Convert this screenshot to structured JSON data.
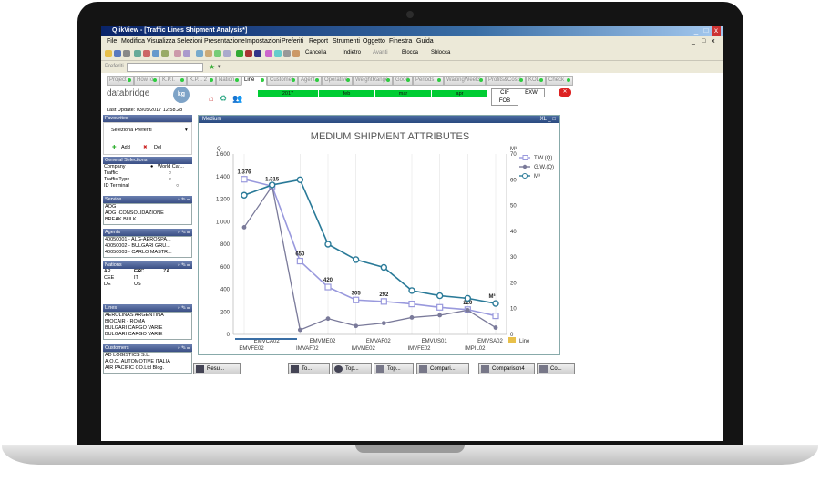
{
  "window": {
    "title": "QlikView - [Traffic Lines Shipment Analysis*]",
    "controls": [
      "_",
      "□",
      "x"
    ]
  },
  "menu": [
    "File",
    "Modifica",
    "Visualizza",
    "Selezioni",
    "Presentazione",
    "Impostazioni",
    "Preferiti",
    "Report",
    "Strumenti",
    "Oggetto",
    "Finestra",
    "Guida"
  ],
  "toolbar": {
    "cancella": "Cancella",
    "indietro": "Indietro",
    "avanti": "Avanti",
    "blocca": "Blocca",
    "sblocca": "Sblocca",
    "preferiti_label": "Preferiti"
  },
  "tabs": [
    "Project",
    "HowTo",
    "K.P.I.",
    "K.P.I. 2",
    "Nation",
    "Line",
    "Customer",
    "Agent",
    "Operative",
    "WeightRange",
    "Good",
    "Periods",
    "WaitingWeeks",
    "Profits&Costs",
    "KOL",
    "Check"
  ],
  "active_tab": "Line",
  "logo": {
    "name": "databridge",
    "badge": "kg"
  },
  "filters": {
    "year": "2017",
    "months": [
      "feb",
      "mar",
      "apr"
    ],
    "terms": [
      "CIF",
      "EXW",
      "FOB"
    ]
  },
  "last_update": "Last Update: 03/05/2017 12.58.28",
  "favourites": {
    "header": "Favourites",
    "select": "Seleziona Preferiti",
    "add": "Add",
    "del": "Del"
  },
  "general_selections": {
    "header": "General Selections",
    "rows": [
      {
        "label": "Company",
        "value": "World Car..."
      },
      {
        "label": "Traffic",
        "value": ""
      },
      {
        "label": "Traffic Type",
        "value": ""
      },
      {
        "label": "ID Terminal",
        "value": ""
      }
    ]
  },
  "service": {
    "header": "Service",
    "items": [
      "AOG",
      "AOG -CONSOLIDAZIONE",
      "BREAK BULK"
    ]
  },
  "agents": {
    "header": "Agents",
    "items": [
      "40050001 - ALG-AEROSPA...",
      "40050002 - BULGARI GRU...",
      "40050003 - CARLO MASTR..."
    ]
  },
  "nations": {
    "header": "Nations",
    "rows": [
      [
        "",
        "EXC",
        "ZA"
      ],
      [
        "AR",
        "GR",
        ""
      ],
      [
        "CEE",
        "IT",
        ""
      ],
      [
        "DE",
        "US",
        ""
      ]
    ]
  },
  "lines": {
    "header": "Lines",
    "items": [
      "AEROLINAS ARGENTINA",
      "BIOCAIR - ROMA",
      "BULGARI CARGO VARIE",
      "BULGARI CARGO VARIE"
    ]
  },
  "customers": {
    "header": "Customers",
    "items": [
      "AD LOGISTICS S.L.",
      "A.O.C. AUTOMOTIVE ITALIA",
      "AIR PACIFIC CO.Ltd   Blog."
    ]
  },
  "chart_panel": {
    "header": "Medium",
    "icons": "XL _ □"
  },
  "bottom_buttons": [
    "Resu...",
    "To...",
    "Top...",
    "Top...",
    "Compari...",
    "Comparison4",
    "Co..."
  ],
  "chart_data": {
    "type": "line",
    "title": "MEDIUM SHIPMENT ATTRIBUTES",
    "ylabel_left": "Q",
    "ylabel_right": "M³",
    "xlabel": "Line",
    "ylim_left": [
      0,
      1600
    ],
    "yticks_left": [
      0,
      200,
      400,
      600,
      800,
      1000,
      1200,
      1400,
      1600
    ],
    "ylim_right": [
      0,
      70
    ],
    "yticks_right": [
      0,
      10,
      20,
      30,
      40,
      50,
      60,
      70
    ],
    "x_upper_labels": [
      "EMVCA02",
      "EMVME02",
      "EMVAF02",
      "EMVUS01",
      "EMVSA02"
    ],
    "x_lower_labels": [
      "EMVFE02",
      "IMVAF02",
      "IMVME02",
      "IMVFE02",
      "IMPIL02"
    ],
    "legend": [
      "T.W.(Q)",
      "G.W.(Q)",
      "M³"
    ],
    "colors": {
      "tw": "#9999dd",
      "gw": "#7a7a9a",
      "m3": "#2a7a98"
    },
    "series": [
      {
        "name": "T.W.(Q)",
        "axis": "left",
        "values": [
          1376,
          1315,
          650,
          420,
          305,
          292,
          270,
          240,
          220,
          165
        ],
        "labels": [
          "1.376",
          "1.315",
          "650",
          "420",
          "305",
          "292",
          "",
          "",
          "220",
          ""
        ]
      },
      {
        "name": "G.W.(Q)",
        "axis": "left",
        "values": [
          950,
          1315,
          40,
          140,
          75,
          100,
          150,
          170,
          215,
          60
        ],
        "labels": [
          "",
          "",
          "",
          "",
          "",
          "",
          "",
          "",
          "",
          ""
        ]
      },
      {
        "name": "M³",
        "axis": "right",
        "values": [
          54,
          58,
          60,
          35,
          29,
          26,
          17,
          15,
          14,
          12
        ],
        "labels": [
          "",
          "",
          "",
          "",
          "",
          "",
          "",
          "",
          "",
          "M³"
        ]
      }
    ]
  }
}
